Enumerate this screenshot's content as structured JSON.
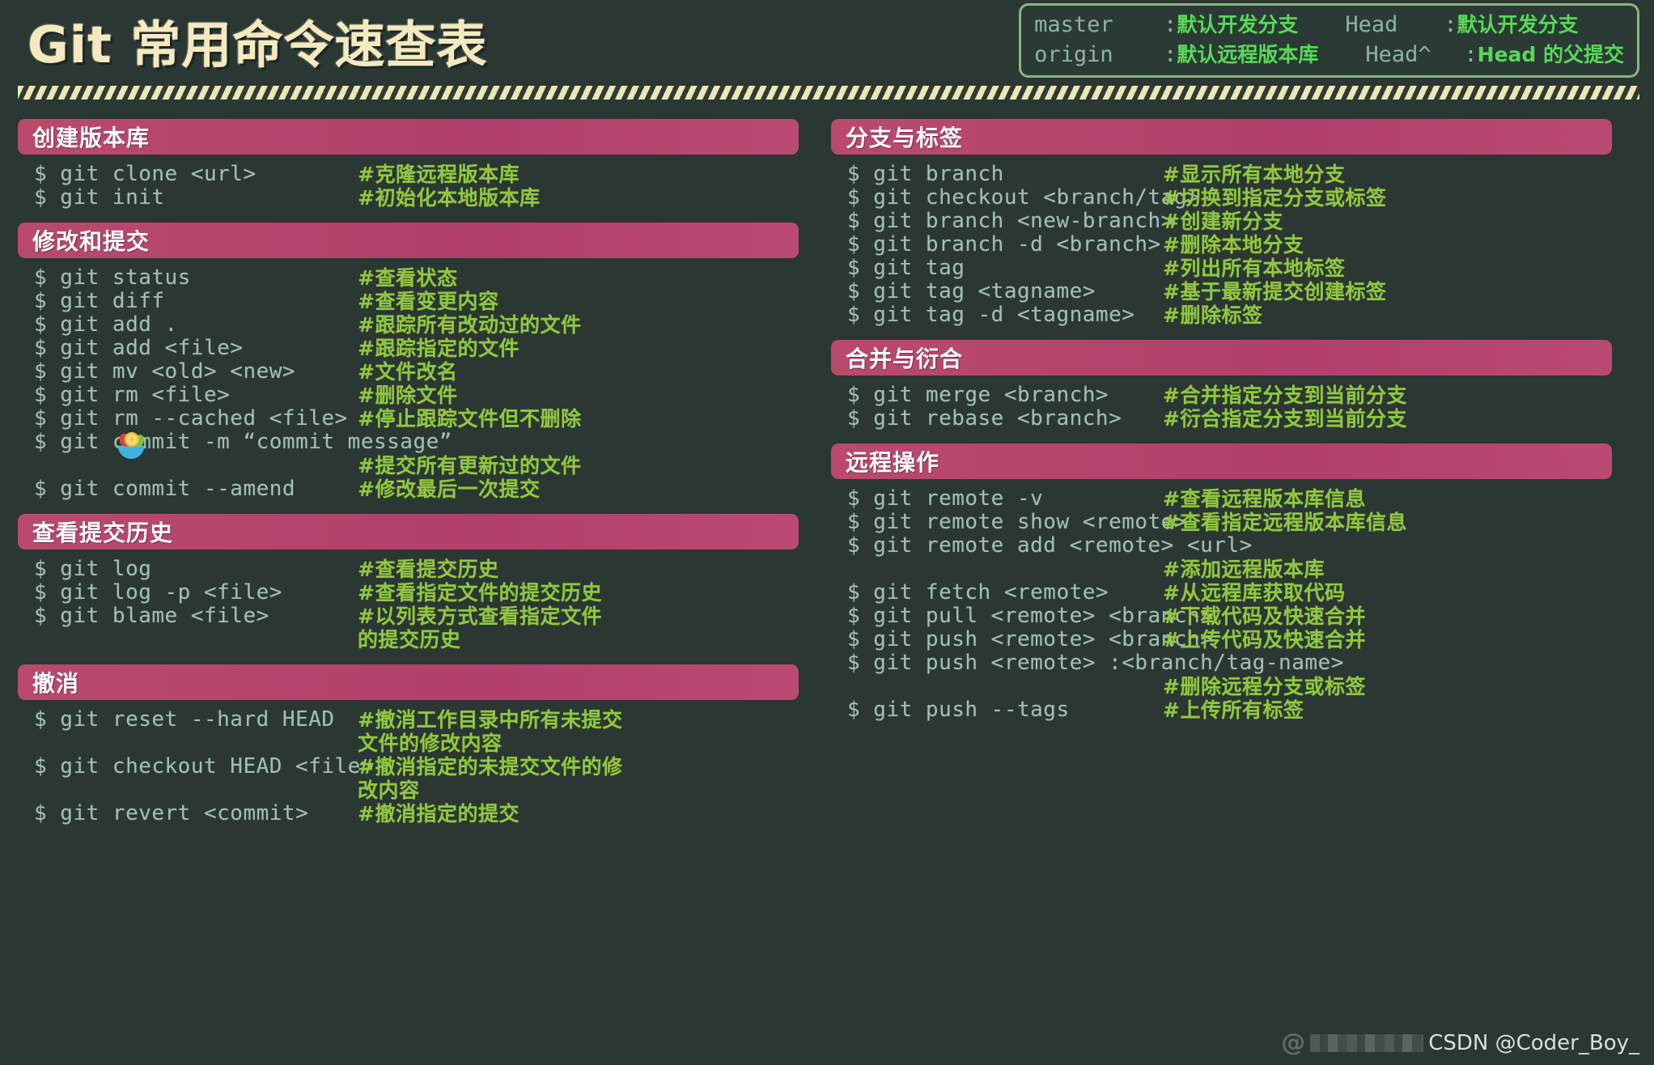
{
  "colors": {
    "background": "#2a3733",
    "header_bar": "#b94a6c",
    "title": "#f5e9bf",
    "command": "#a5bdb3",
    "comment": "#93c63f",
    "legend_border": "#88b87e",
    "legend_term": "#8fb2a8",
    "legend_def": "#57d957",
    "stripe": "#ece6b8"
  },
  "header": {
    "title": "Git 常用命令速查表",
    "legend": [
      {
        "left_term": "master",
        "left_sep": ":",
        "left_def": "默认开发分支",
        "right_term": "Head",
        "right_sep": ":",
        "right_def": "默认开发分支"
      },
      {
        "left_term": "origin",
        "left_sep": ":",
        "left_def": "默认远程版本库",
        "right_term": "Head^",
        "right_sep": ":",
        "right_def": "Head 的父提交"
      }
    ]
  },
  "left_column": [
    {
      "title": "创建版本库",
      "rows": [
        {
          "cmd": "$ git clone <url>",
          "cmt": "#克隆远程版本库"
        },
        {
          "cmd": "$ git init",
          "cmt": "#初始化本地版本库"
        }
      ]
    },
    {
      "title": "修改和提交",
      "rows": [
        {
          "cmd": "$ git status",
          "cmt": "#查看状态"
        },
        {
          "cmd": "$ git diff",
          "cmt": "#查看变更内容"
        },
        {
          "cmd": "$ git add .",
          "cmt": "#跟踪所有改动过的文件"
        },
        {
          "cmd": "$ git add <file>",
          "cmt": "#跟踪指定的文件"
        },
        {
          "cmd": "$ git mv <old> <new>",
          "cmt": "#文件改名"
        },
        {
          "cmd": "$ git rm <file>",
          "cmt": "#删除文件"
        },
        {
          "cmd": "$ git rm --cached <file>",
          "cmt": "#停止跟踪文件但不删除"
        },
        {
          "cmd": "$ git commit -m “commit message”",
          "cmt": ""
        },
        {
          "cmd": "",
          "cmt": "#提交所有更新过的文件"
        },
        {
          "cmd": "$ git commit --amend",
          "cmt": "#修改最后一次提交"
        }
      ]
    },
    {
      "title": "查看提交历史",
      "rows": [
        {
          "cmd": "$ git log",
          "cmt": "#查看提交历史"
        },
        {
          "cmd": "$ git log -p <file>",
          "cmt": "#查看指定文件的提交历史"
        },
        {
          "cmd": "$ git blame <file>",
          "cmt": "#以列表方式查看指定文件"
        },
        {
          "cmd": "",
          "cmt": "的提交历史"
        }
      ]
    },
    {
      "title": "撤消",
      "rows": [
        {
          "cmd": "$ git reset --hard HEAD",
          "cmt": "#撤消工作目录中所有未提交"
        },
        {
          "cmd": "",
          "cmt": "文件的修改内容"
        },
        {
          "cmd": "$ git checkout HEAD <file>",
          "cmt": "#撤消指定的未提交文件的修"
        },
        {
          "cmd": "",
          "cmt": "改内容"
        },
        {
          "cmd": "$ git revert <commit>",
          "cmt": "#撤消指定的提交"
        }
      ]
    }
  ],
  "right_column": [
    {
      "title": "分支与标签",
      "rows": [
        {
          "cmd": "$ git branch",
          "cmt": "#显示所有本地分支"
        },
        {
          "cmd": "$ git checkout <branch/tag>",
          "cmt": "#切换到指定分支或标签"
        },
        {
          "cmd": "$ git branch <new-branch>",
          "cmt": "#创建新分支"
        },
        {
          "cmd": "$ git branch -d <branch>",
          "cmt": "#删除本地分支"
        },
        {
          "cmd": "$ git tag",
          "cmt": "#列出所有本地标签"
        },
        {
          "cmd": "$ git tag <tagname>",
          "cmt": "#基于最新提交创建标签"
        },
        {
          "cmd": "$ git tag -d <tagname>",
          "cmt": "#删除标签"
        }
      ]
    },
    {
      "title": "合并与衍合",
      "rows": [
        {
          "cmd": "$ git merge <branch>",
          "cmt": "#合并指定分支到当前分支"
        },
        {
          "cmd": "$ git rebase <branch>",
          "cmt": "#衍合指定分支到当前分支"
        }
      ]
    },
    {
      "title": "远程操作",
      "rows": [
        {
          "cmd": "$ git remote -v",
          "cmt": "#查看远程版本库信息"
        },
        {
          "cmd": "$ git remote show <remote>",
          "cmt": "#查看指定远程版本库信息"
        },
        {
          "cmd": "$ git remote add <remote> <url>",
          "cmt": ""
        },
        {
          "cmd": "",
          "cmt": "#添加远程版本库"
        },
        {
          "cmd": "$ git fetch <remote>",
          "cmt": "#从远程库获取代码"
        },
        {
          "cmd": "$ git pull <remote> <branch>",
          "cmt": "#下载代码及快速合并"
        },
        {
          "cmd": "$ git push <remote> <branch>",
          "cmt": "#上传代码及快速合并"
        },
        {
          "cmd": "$ git push <remote> :<branch/tag-name>",
          "cmt": ""
        },
        {
          "cmd": "",
          "cmt": "#删除远程分支或标签"
        },
        {
          "cmd": "$ git push --tags",
          "cmt": "#上传所有标签"
        }
      ]
    }
  ],
  "overlay": {
    "emoji_icon": "salad-bowl-emoji"
  },
  "watermark": {
    "at_symbol": "@",
    "text": "CSDN @Coder_Boy_"
  }
}
